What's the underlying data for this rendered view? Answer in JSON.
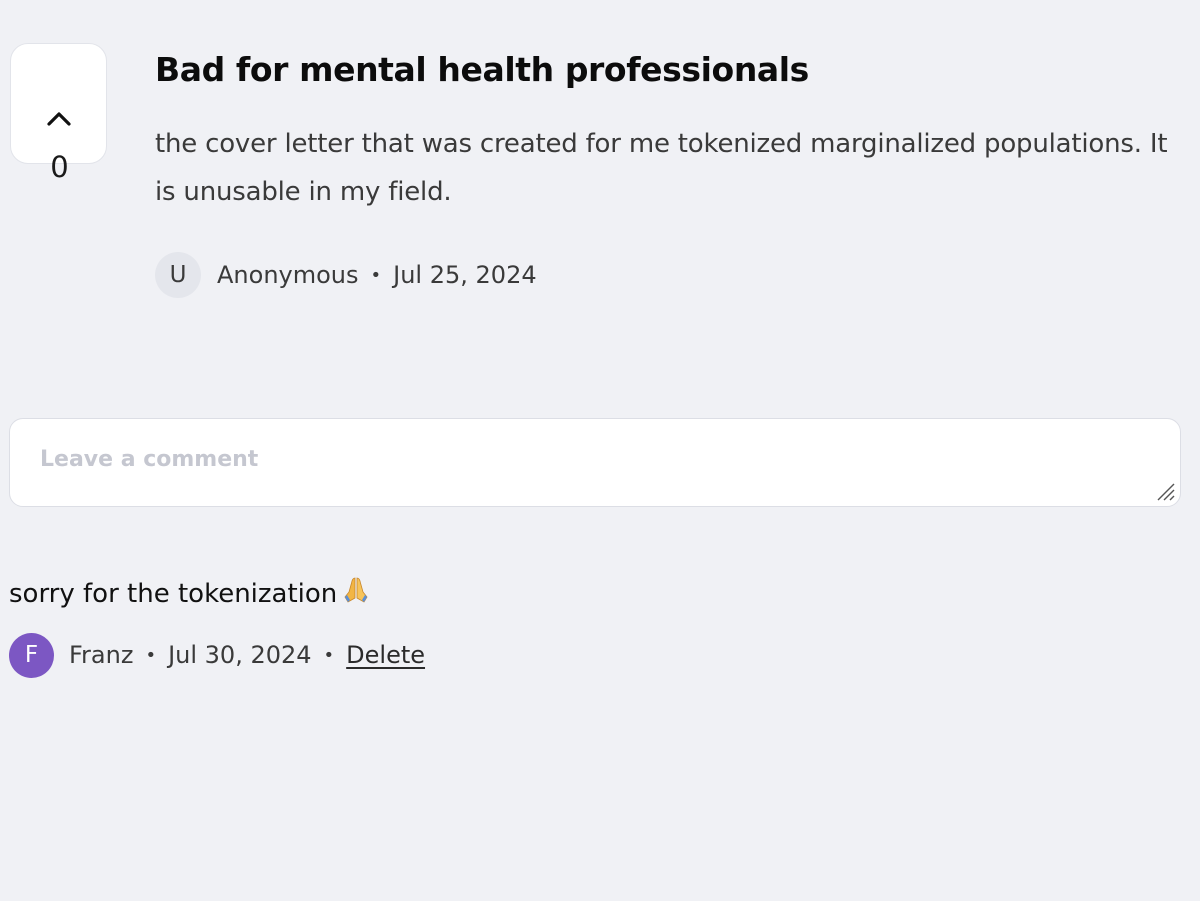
{
  "post": {
    "upvote_count": "0",
    "title": "Bad for mental health professionals",
    "body": "the cover letter that was created for me tokenized marginalized populations. It is unusable in my field.",
    "author_initial": "U",
    "author": "Anonymous",
    "separator": "•",
    "date": "Jul 25, 2024"
  },
  "comment_form": {
    "placeholder": "Leave a comment"
  },
  "comments": [
    {
      "text": "sorry for the tokenization",
      "emoji": "folded-hands-icon",
      "author_initial": "F",
      "author": "Franz",
      "date": "Jul 30, 2024",
      "delete_label": "Delete",
      "avatar_color": "#7c57c3"
    }
  ],
  "colors": {
    "background": "#f0f1f5",
    "card": "#ffffff",
    "placeholder": "#c5c7d0",
    "avatar_anonymous": "#e4e6ec"
  }
}
